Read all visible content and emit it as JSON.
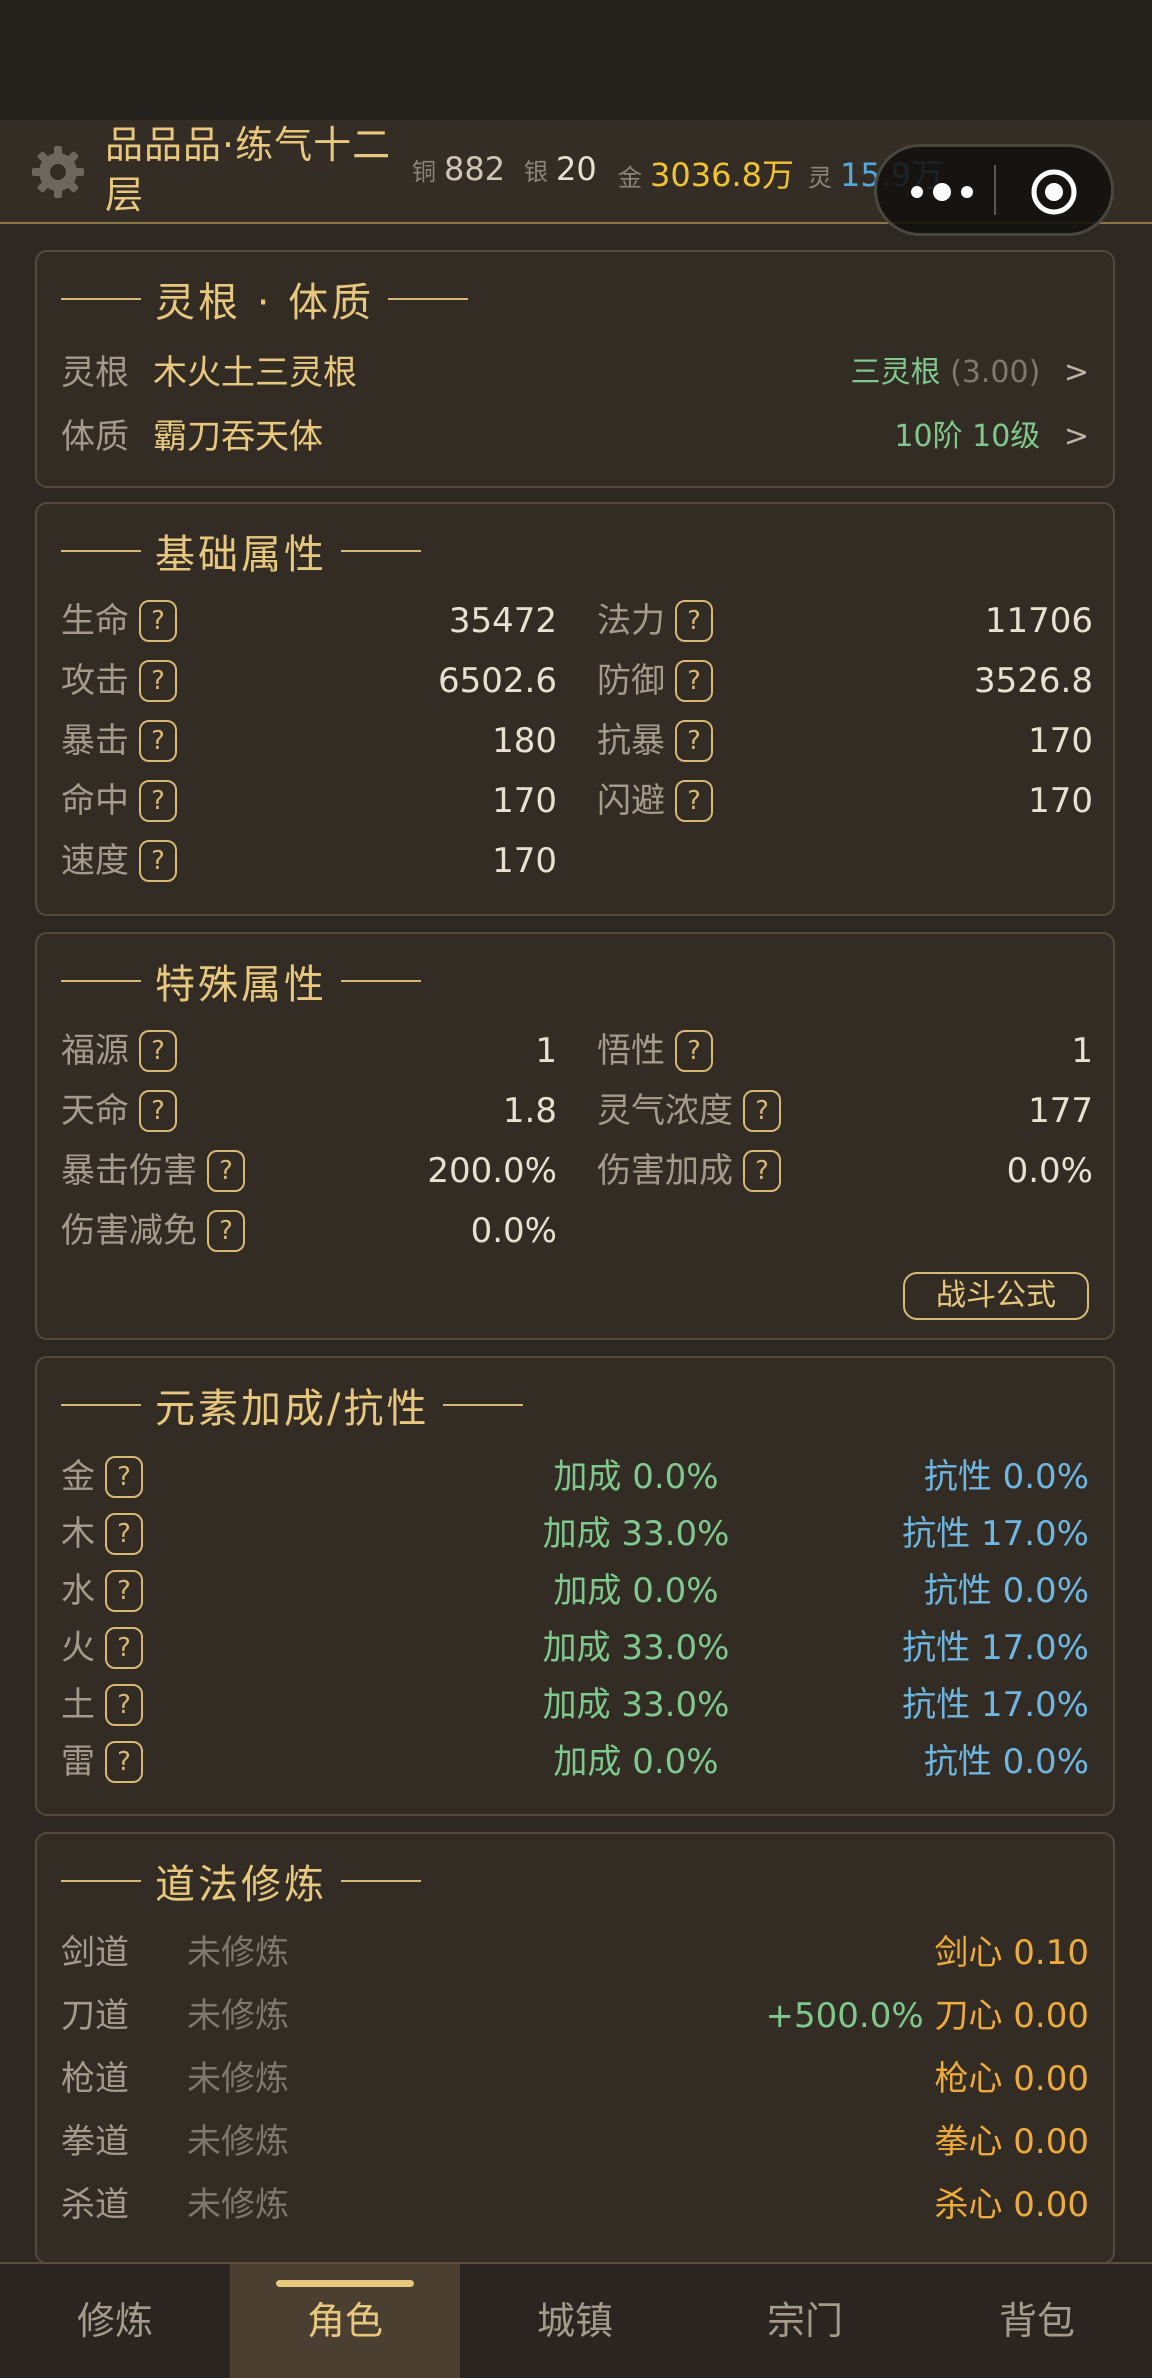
{
  "header": {
    "title": "品品品·练气十二层",
    "currency": [
      {
        "label": "铜",
        "value": "882",
        "color": "#cfc6b4"
      },
      {
        "label": "银",
        "value": "20",
        "color": "#e9e1d0"
      },
      {
        "label": "金",
        "value": "3036.8万",
        "color": "#f1c232"
      },
      {
        "label": "灵",
        "value": "15.9万",
        "color": "#55aadd"
      }
    ]
  },
  "root": {
    "title": "灵根 · 体质",
    "linggen_label": "灵根",
    "linggen_value": "木火土三灵根",
    "linggen_grade": "三灵根",
    "linggen_score": "(3.00)",
    "tizhi_label": "体质",
    "tizhi_value": "霸刀吞天体",
    "tizhi_grade": "10阶 10级",
    "arrow": ">"
  },
  "basic": {
    "title": "基础属性",
    "items": [
      {
        "name": "生命",
        "value": "35472"
      },
      {
        "name": "法力",
        "value": "11706"
      },
      {
        "name": "攻击",
        "value": "6502.6"
      },
      {
        "name": "防御",
        "value": "3526.8"
      },
      {
        "name": "暴击",
        "value": "180"
      },
      {
        "name": "抗暴",
        "value": "170"
      },
      {
        "name": "命中",
        "value": "170"
      },
      {
        "name": "闪避",
        "value": "170"
      },
      {
        "name": "速度",
        "value": "170"
      }
    ]
  },
  "special": {
    "title": "特殊属性",
    "items": [
      {
        "name": "福源",
        "value": "1"
      },
      {
        "name": "悟性",
        "value": "1"
      },
      {
        "name": "天命",
        "value": "1.8"
      },
      {
        "name": "灵气浓度",
        "value": "177"
      },
      {
        "name": "暴击伤害",
        "value": "200.0%"
      },
      {
        "name": "伤害加成",
        "value": "0.0%"
      },
      {
        "name": "伤害减免",
        "value": "0.0%"
      }
    ],
    "formula_button": "战斗公式"
  },
  "elements": {
    "title": "元素加成/抗性",
    "items": [
      {
        "name": "金",
        "bonus": "加成 0.0%",
        "resist": "抗性 0.0%"
      },
      {
        "name": "木",
        "bonus": "加成 33.0%",
        "resist": "抗性 17.0%"
      },
      {
        "name": "水",
        "bonus": "加成 0.0%",
        "resist": "抗性 0.0%"
      },
      {
        "name": "火",
        "bonus": "加成 33.0%",
        "resist": "抗性 17.0%"
      },
      {
        "name": "土",
        "bonus": "加成 33.0%",
        "resist": "抗性 17.0%"
      },
      {
        "name": "雷",
        "bonus": "加成 0.0%",
        "resist": "抗性 0.0%"
      }
    ]
  },
  "tao": {
    "title": "道法修炼",
    "items": [
      {
        "name": "剑道",
        "state": "未修炼",
        "extra": "",
        "heart": "剑心 0.10"
      },
      {
        "name": "刀道",
        "state": "未修炼",
        "extra": "+500.0%",
        "heart": "刀心 0.00"
      },
      {
        "name": "枪道",
        "state": "未修炼",
        "extra": "",
        "heart": "枪心 0.00"
      },
      {
        "name": "拳道",
        "state": "未修炼",
        "extra": "",
        "heart": "拳心 0.00"
      },
      {
        "name": "杀道",
        "state": "未修炼",
        "extra": "",
        "heart": "杀心 0.00"
      }
    ]
  },
  "help_mark": "?",
  "tabs": [
    {
      "label": "修炼",
      "active": false
    },
    {
      "label": "角色",
      "active": true
    },
    {
      "label": "城镇",
      "active": false
    },
    {
      "label": "宗门",
      "active": false
    },
    {
      "label": "背包",
      "active": false
    }
  ],
  "colors": {
    "accent_gold": "#e8c87e",
    "positive_green": "#7fc98c",
    "resist_blue": "#6fb6e0",
    "heart_orange": "#eeaa3a",
    "background": "#2d2822"
  },
  "icons": [
    "gear-icon",
    "more-dots-icon",
    "target-icon",
    "help-icon"
  ]
}
